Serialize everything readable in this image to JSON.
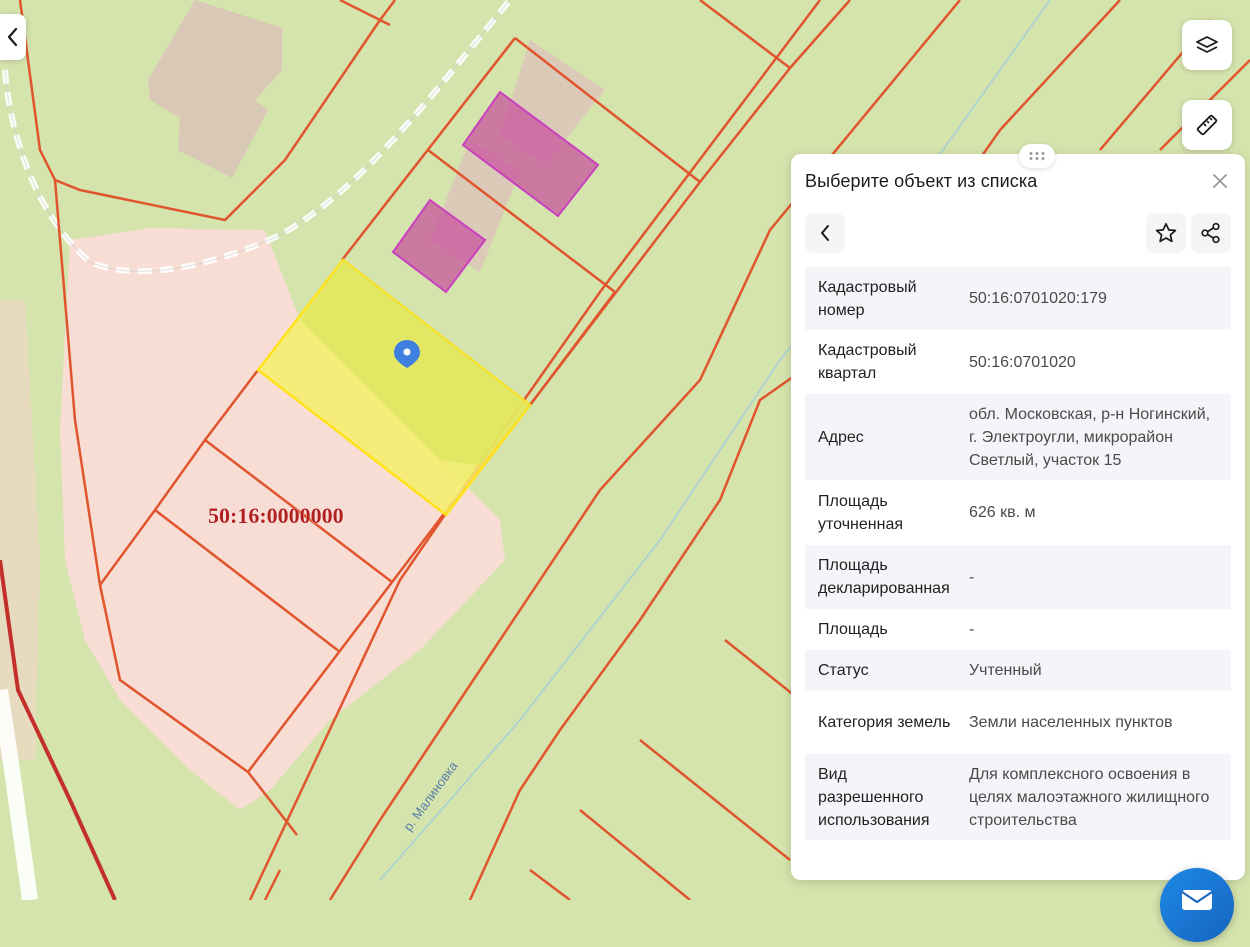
{
  "map": {
    "cadastral_block_label": "50:16:0000000",
    "river_label": "р. Малиновка",
    "colors": {
      "background": "#d5e3ad",
      "parcel_border": "#e0552d",
      "selected_parcel_fill": "#f4ee6a",
      "building_fill": "#c9509e",
      "settlement_fill": "#f7ddd4",
      "marker": "#3f7fe0"
    }
  },
  "controls": {
    "back_icon": "chevron-left-icon",
    "layers_icon": "layers-icon",
    "ruler_icon": "ruler-icon"
  },
  "panel": {
    "title": "Выберите объект из списка",
    "rows": [
      {
        "key": "Кадастровый номер",
        "value": "50:16:0701020:179"
      },
      {
        "key": "Кадастровый квартал",
        "value": "50:16:0701020"
      },
      {
        "key": "Адрес",
        "value": "обл. Московская, р-н Ногинский, г. Электроугли, микрорайон Светлый, участок 15"
      },
      {
        "key": "Площадь уточненная",
        "value": "626 кв. м"
      },
      {
        "key": "Площадь декларированная",
        "value": "-"
      },
      {
        "key": "Площадь",
        "value": "-"
      },
      {
        "key": "Статус",
        "value": "Учтенный"
      },
      {
        "key": "Категория земель",
        "value": "Земли населенных пунктов"
      },
      {
        "key": "Вид разрешенного использования",
        "value": "Для комплексного освоения в целях малоэтажного жилищного строительства"
      }
    ]
  }
}
